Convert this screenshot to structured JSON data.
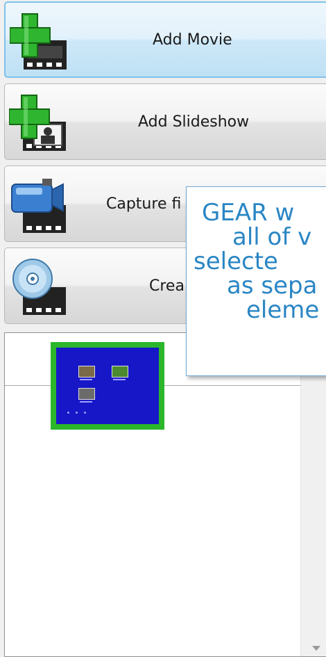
{
  "buttons": {
    "add_movie": "Add Movie",
    "add_slideshow": "Add Slideshow",
    "capture": "Capture fi",
    "create": "Crea"
  },
  "icons": {
    "add_movie": "plus-film-icon",
    "add_slideshow": "plus-photo-film-icon",
    "capture": "camera-film-icon",
    "create": "disc-film-icon"
  },
  "tooltip": {
    "lines": [
      "GEAR w",
      "all of v",
      "selecte",
      "as sepa",
      "eleme"
    ]
  },
  "colors": {
    "accent_border": "#7ec2ea",
    "plus_green": "#2fb52f",
    "tooltip_text": "#2a86c4",
    "thumb_border": "#2bb62b",
    "thumb_bg": "#1717c8"
  }
}
